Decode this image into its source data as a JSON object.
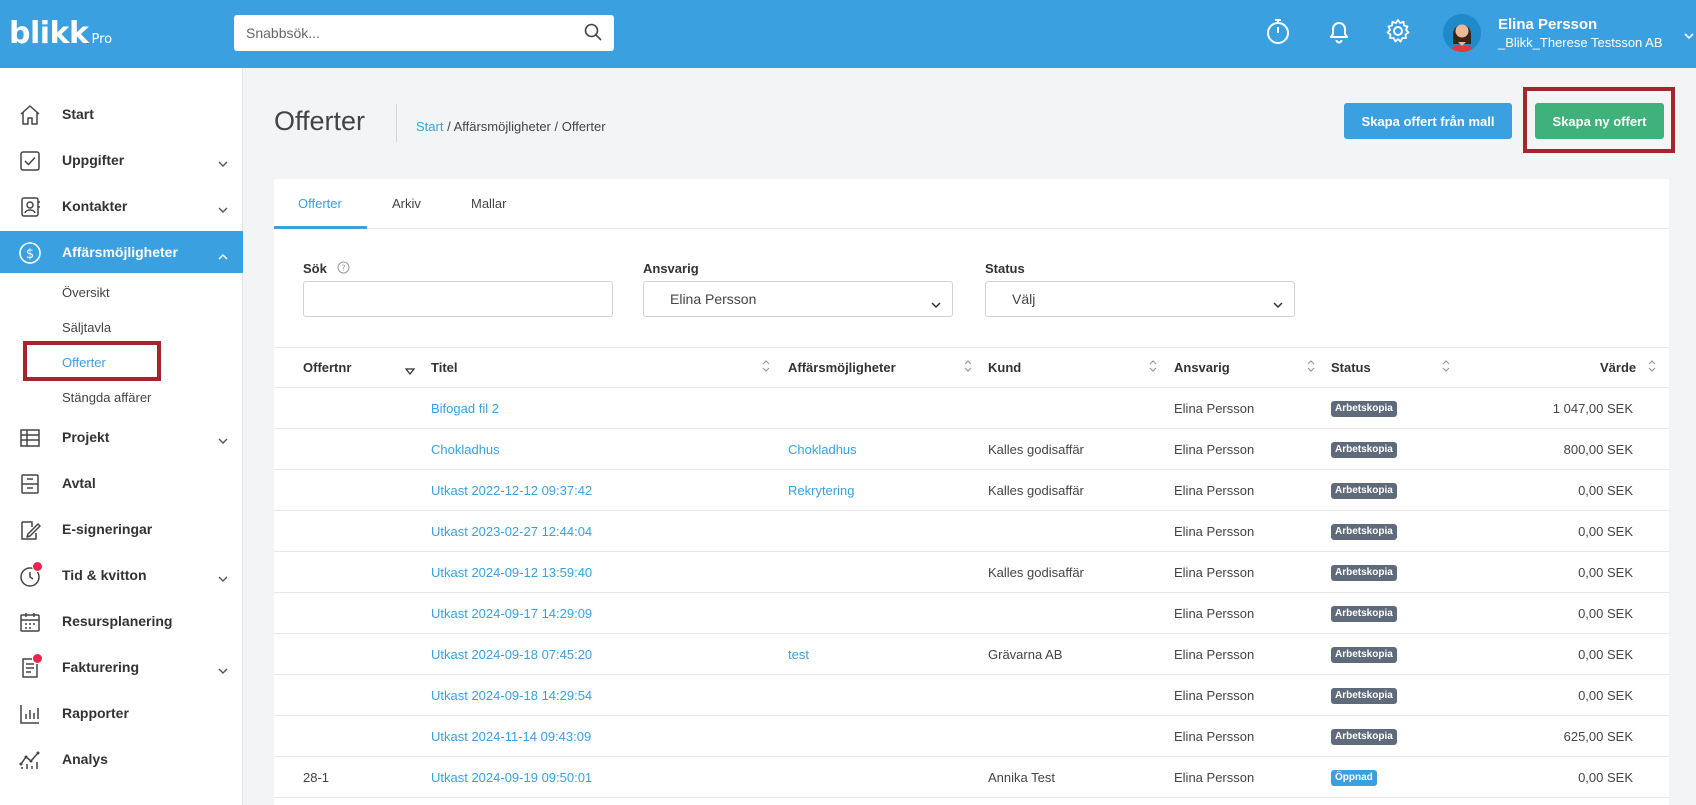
{
  "app": {
    "brand": "blikk",
    "brand_suffix": "Pro",
    "search_placeholder": "Snabbsök...",
    "accent": "#3aa0df"
  },
  "user": {
    "name": "Elina Persson",
    "company": "_Blikk_Therese Testsson AB"
  },
  "sidebar": {
    "items": [
      {
        "label": "Start",
        "icon": "home-icon"
      },
      {
        "label": "Uppgifter",
        "icon": "checkbox-icon"
      },
      {
        "label": "Kontakter",
        "icon": "contacts-icon"
      },
      {
        "label": "Affärsmöjligheter",
        "icon": "dollar-circle-icon"
      },
      {
        "label": "Projekt",
        "icon": "table-icon"
      },
      {
        "label": "Avtal",
        "icon": "archive-icon"
      },
      {
        "label": "E-signeringar",
        "icon": "signature-icon"
      },
      {
        "label": "Tid & kvitton",
        "icon": "clock-icon"
      },
      {
        "label": "Resursplanering",
        "icon": "calendar-icon"
      },
      {
        "label": "Fakturering",
        "icon": "invoice-icon"
      },
      {
        "label": "Rapporter",
        "icon": "bar-chart-icon"
      },
      {
        "label": "Analys",
        "icon": "analytics-icon"
      }
    ],
    "sub_items": [
      "Översikt",
      "Säljtavla",
      "Offerter",
      "Stängda affärer"
    ]
  },
  "page": {
    "title": "Offerter",
    "breadcrumb": {
      "link": "Start",
      "rest": " / Affärsmöjligheter / Offerter"
    },
    "btn_template": "Skapa offert från mall",
    "btn_new": "Skapa ny offert"
  },
  "tabs": [
    "Offerter",
    "Arkiv",
    "Mallar"
  ],
  "filters": {
    "search_label": "Sök",
    "search_value": "",
    "responsible_label": "Ansvarig",
    "responsible_value": "Elina Persson",
    "status_label": "Status",
    "status_value": "Välj"
  },
  "table": {
    "headers": [
      "Offertnr",
      "Titel",
      "Affärsmöjligheter",
      "Kund",
      "Ansvarig",
      "Status",
      "Värde"
    ],
    "rows": [
      {
        "nr": "",
        "title": "Bifogad fil 2",
        "opportunity": "",
        "customer": "",
        "responsible": "Elina Persson",
        "status": "Arbetskopia",
        "value": "1 047,00 SEK"
      },
      {
        "nr": "",
        "title": "Chokladhus",
        "opportunity": "Chokladhus",
        "customer": "Kalles godisaffär",
        "responsible": "Elina Persson",
        "status": "Arbetskopia",
        "value": "800,00 SEK"
      },
      {
        "nr": "",
        "title": "Utkast 2022-12-12 09:37:42",
        "opportunity": "Rekrytering",
        "customer": "Kalles godisaffär",
        "responsible": "Elina Persson",
        "status": "Arbetskopia",
        "value": "0,00 SEK"
      },
      {
        "nr": "",
        "title": "Utkast 2023-02-27 12:44:04",
        "opportunity": "",
        "customer": "",
        "responsible": "Elina Persson",
        "status": "Arbetskopia",
        "value": "0,00 SEK"
      },
      {
        "nr": "",
        "title": "Utkast 2024-09-12 13:59:40",
        "opportunity": "",
        "customer": "Kalles godisaffär",
        "responsible": "Elina Persson",
        "status": "Arbetskopia",
        "value": "0,00 SEK"
      },
      {
        "nr": "",
        "title": "Utkast 2024-09-17 14:29:09",
        "opportunity": "",
        "customer": "",
        "responsible": "Elina Persson",
        "status": "Arbetskopia",
        "value": "0,00 SEK"
      },
      {
        "nr": "",
        "title": "Utkast 2024-09-18 07:45:20",
        "opportunity": "test",
        "customer": "Grävarna AB",
        "responsible": "Elina Persson",
        "status": "Arbetskopia",
        "value": "0,00 SEK"
      },
      {
        "nr": "",
        "title": "Utkast 2024-09-18 14:29:54",
        "opportunity": "",
        "customer": "",
        "responsible": "Elina Persson",
        "status": "Arbetskopia",
        "value": "0,00 SEK"
      },
      {
        "nr": "",
        "title": "Utkast 2024-11-14 09:43:09",
        "opportunity": "",
        "customer": "",
        "responsible": "Elina Persson",
        "status": "Arbetskopia",
        "value": "625,00 SEK"
      },
      {
        "nr": "28-1",
        "title": "Utkast 2024-09-19 09:50:01",
        "opportunity": "",
        "customer": "Annika Test",
        "responsible": "Elina Persson",
        "status": "Öppnad",
        "value": "0,00 SEK"
      }
    ]
  },
  "status_colors": {
    "Arbetskopia": "#5f6b7a",
    "Öppnad": "#3aa0df"
  }
}
